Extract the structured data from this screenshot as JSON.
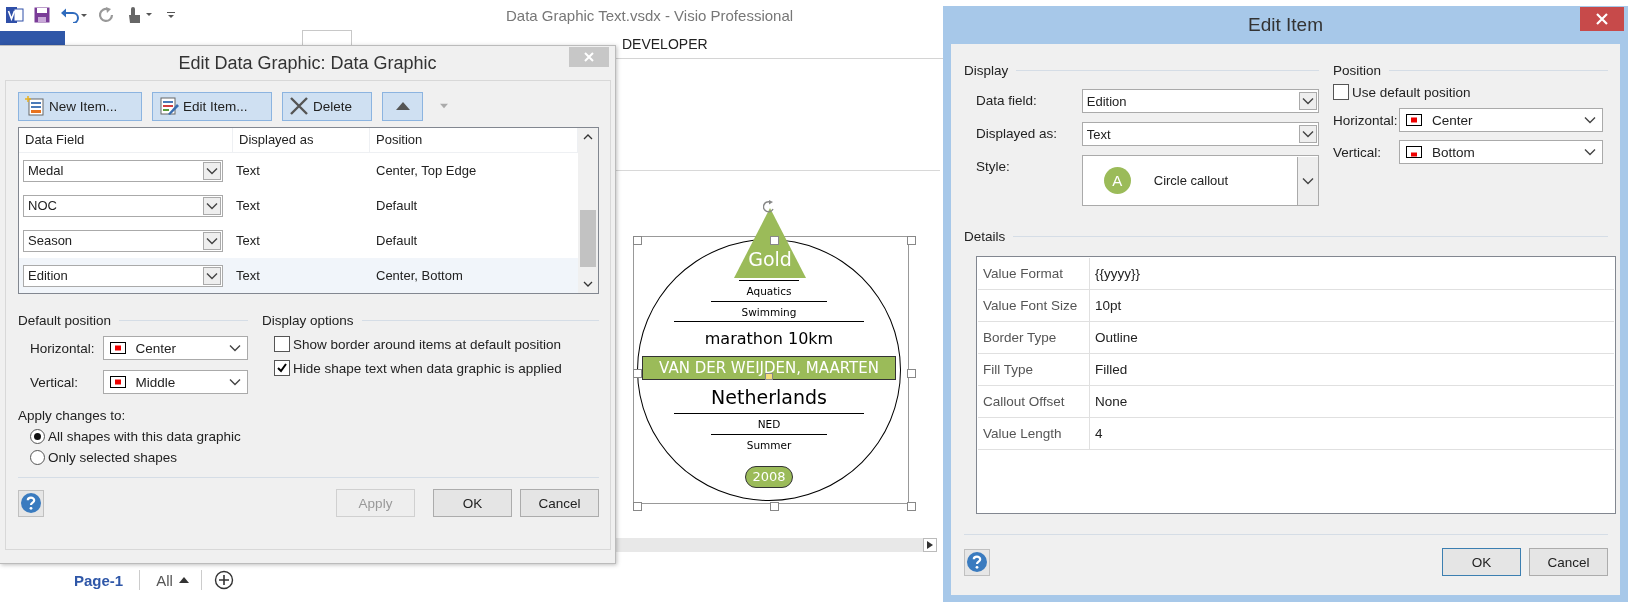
{
  "app": {
    "title": "Data Graphic Text.vsdx - Visio Professional",
    "ribbon_tabs": [
      {
        "label": "DEVELOPER"
      }
    ]
  },
  "shape": {
    "items": [
      {
        "text": "Gold",
        "kind": "triangle"
      },
      {
        "kind": "shortrule"
      },
      {
        "text": "Aquatics",
        "kind": "small"
      },
      {
        "kind": "mediumrule"
      },
      {
        "text": "Swimming",
        "kind": "small"
      },
      {
        "kind": "longrule"
      },
      {
        "text": "marathon 10km",
        "kind": "medium"
      },
      {
        "text": "VAN DER WEIJDEN, MAARTEN",
        "kind": "banner"
      },
      {
        "text": "Netherlands",
        "kind": "large"
      },
      {
        "kind": "longrule"
      },
      {
        "text": "NED",
        "kind": "small"
      },
      {
        "kind": "mediumrule"
      },
      {
        "text": "Summer",
        "kind": "small"
      },
      {
        "text": "2008",
        "kind": "pill"
      }
    ]
  },
  "page_tabs": {
    "page": "Page-1",
    "all": "All"
  },
  "edit_data_graphic": {
    "title": "Edit Data Graphic: Data Graphic",
    "toolbar": [
      {
        "label": "New Item...",
        "kind": "new"
      },
      {
        "label": "Edit Item...",
        "kind": "edit"
      },
      {
        "label": "Delete",
        "kind": "delete"
      }
    ],
    "move_up": {
      "disabled": false
    },
    "move_down": {
      "disabled": true
    },
    "columns": [
      "Data Field",
      "Displayed as",
      "Position"
    ],
    "rows": [
      {
        "field": "Medal",
        "displayed_as": "Text",
        "position": "Center, Top Edge",
        "selected": false
      },
      {
        "field": "NOC",
        "displayed_as": "Text",
        "position": "Default",
        "selected": false
      },
      {
        "field": "Season",
        "displayed_as": "Text",
        "position": "Default",
        "selected": false
      },
      {
        "field": "Edition",
        "displayed_as": "Text",
        "position": "Center, Bottom",
        "selected": true
      }
    ],
    "default_position": {
      "title": "Default position",
      "horizontal": {
        "label": "Horizontal:",
        "value": "Center",
        "kind": "center"
      },
      "vertical": {
        "label": "Vertical:",
        "value": "Middle",
        "kind": "center"
      }
    },
    "display_options": {
      "title": "Display options",
      "options": [
        {
          "label": "Show border around items at default position",
          "checked": false
        },
        {
          "label": "Hide shape text when data graphic is applied",
          "checked": true
        }
      ]
    },
    "apply_changes": {
      "title": "Apply changes to:",
      "options": [
        {
          "label": "All shapes with this data graphic",
          "selected": true
        },
        {
          "label": "Only selected shapes",
          "selected": false
        }
      ]
    },
    "buttons": [
      {
        "label": "Apply",
        "disabled": true
      },
      {
        "label": "OK",
        "disabled": false
      },
      {
        "label": "Cancel",
        "disabled": false
      }
    ]
  },
  "edit_item": {
    "title": "Edit Item",
    "display": {
      "title": "Display",
      "data_field": {
        "label": "Data field:",
        "value": "Edition"
      },
      "displayed_as": {
        "label": "Displayed as:",
        "value": "Text"
      },
      "style": {
        "label": "Style:",
        "badge": "A",
        "value": "Circle callout"
      }
    },
    "position": {
      "title": "Position",
      "use_default": {
        "label": "Use default position",
        "checked": false
      },
      "horizontal": {
        "label": "Horizontal:",
        "value": "Center",
        "kind": "center"
      },
      "vertical": {
        "label": "Vertical:",
        "value": "Bottom",
        "kind": "bottom"
      }
    },
    "details": {
      "title": "Details",
      "rows": [
        {
          "name": "Value Format",
          "value": "{{yyyy}}"
        },
        {
          "name": "Value Font Size",
          "value": "10pt"
        },
        {
          "name": "Border Type",
          "value": "Outline"
        },
        {
          "name": "Fill Type",
          "value": "Filled"
        },
        {
          "name": "Callout Offset",
          "value": "None"
        },
        {
          "name": "Value Length",
          "value": "4"
        }
      ]
    },
    "buttons": [
      {
        "label": "OK",
        "default": true
      },
      {
        "label": "Cancel",
        "default": false
      }
    ]
  }
}
